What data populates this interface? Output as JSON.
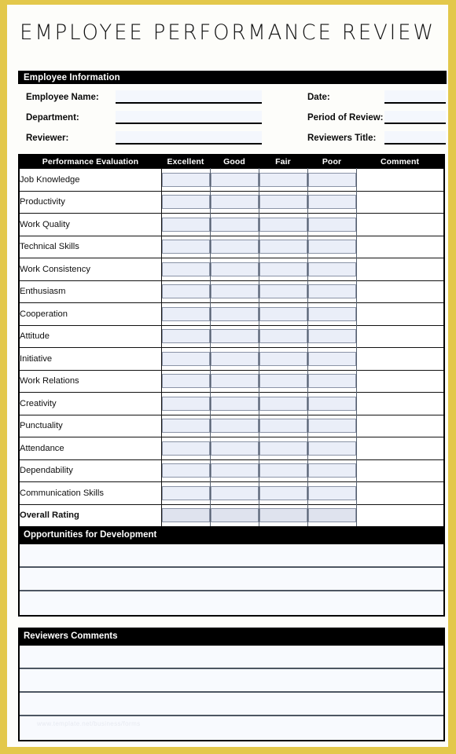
{
  "document": {
    "title": "EMPLOYEE  PERFORMANCE  REVIEW"
  },
  "employee_information": {
    "section_title": "Employee Information",
    "left_fields": [
      {
        "label": "Employee Name:",
        "value": ""
      },
      {
        "label": "Department:",
        "value": ""
      },
      {
        "label": "Reviewer:",
        "value": ""
      }
    ],
    "right_fields": [
      {
        "label": "Date:",
        "value": ""
      },
      {
        "label": "Period of Review:",
        "value": ""
      },
      {
        "label": "Reviewers Title:",
        "value": ""
      }
    ]
  },
  "evaluation_table": {
    "headers": [
      "Performance Evaluation",
      "Excellent",
      "Good",
      "Fair",
      "Poor",
      "Comment"
    ],
    "criteria": [
      "Job Knowledge",
      "Productivity",
      "Work Quality",
      "Technical Skills",
      "Work Consistency",
      "Enthusiasm",
      "Cooperation",
      "Attitude",
      "Initiative",
      "Work Relations",
      "Creativity",
      "Punctuality",
      "Attendance",
      "Dependability",
      "Communication Skills"
    ],
    "summary_row_label": "Overall Rating"
  },
  "opportunities_section": {
    "section_title": "Opportunities for Development",
    "line_count": 3
  },
  "comments_section": {
    "section_title": "Reviewers Comments",
    "line_count": 4,
    "watermark": "www.template.net/business/forms"
  },
  "colors": {
    "frame": "#e3c84b",
    "header_bar": "#000000",
    "header_text": "#ffffff",
    "checkbox_fill": "#eaeef8",
    "checkbox_border": "#8a93a6",
    "overall_label_fill": "#c9c9c9",
    "overall_row_fill": "#d4d9e6",
    "rule_line": "#4d5662"
  }
}
